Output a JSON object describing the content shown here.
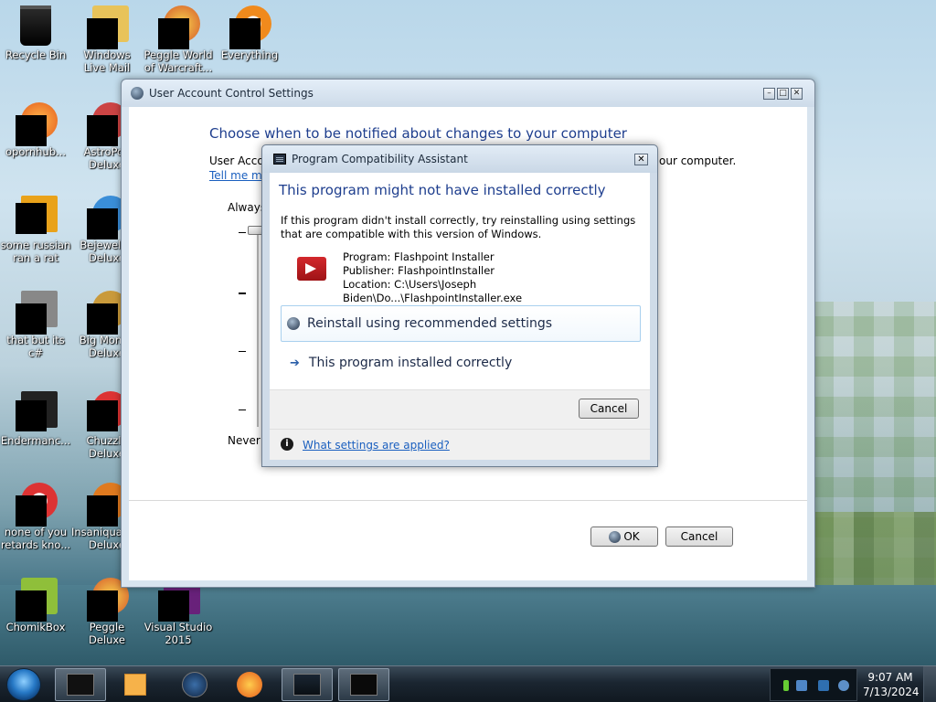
{
  "desktop": {
    "icons": [
      {
        "label": "Recycle Bin"
      },
      {
        "label": "Windows Live Mail"
      },
      {
        "label": "Peggle World of Warcraft..."
      },
      {
        "label": "Everything"
      },
      {
        "label": "opornhub..."
      },
      {
        "label": "AstroPop Deluxe"
      },
      {
        "label": "some russian ran a rat"
      },
      {
        "label": "Bejeweled Deluxe"
      },
      {
        "label": "that but its c#"
      },
      {
        "label": "Big Money Deluxe"
      },
      {
        "label": "Endermanc..."
      },
      {
        "label": "Chuzzle Deluxe"
      },
      {
        "label": "none of you retards kno..."
      },
      {
        "label": "Insaniquarium Deluxe"
      },
      {
        "label": "ChomikBox"
      },
      {
        "label": "Peggle Deluxe"
      },
      {
        "label": "Visual Studio 2015"
      }
    ]
  },
  "uac": {
    "title": "User Account Control Settings",
    "heading": "Choose when to be notified about changes to your computer",
    "desc_left": "User Accou",
    "desc_right": "our computer.",
    "tell_more": "Tell me mo",
    "always": "Always",
    "never": "Never n",
    "ok": "OK",
    "cancel": "Cancel"
  },
  "pca": {
    "title": "Program Compatibility Assistant",
    "heading": "This program might not have installed correctly",
    "intro": "If this program didn't install correctly, try reinstalling using settings that are compatible with this version of Windows.",
    "program": "Program: Flashpoint Installer",
    "publisher": "Publisher: FlashpointInstaller",
    "location": "Location: C:\\Users\\Joseph Biden\\Do...\\FlashpointInstaller.exe",
    "option_reinstall": "Reinstall using recommended settings",
    "option_correct": "This program installed correctly",
    "cancel": "Cancel",
    "help_link": "What settings are applied?"
  },
  "taskbar": {
    "time": "9:07 AM",
    "date": "7/13/2024"
  }
}
